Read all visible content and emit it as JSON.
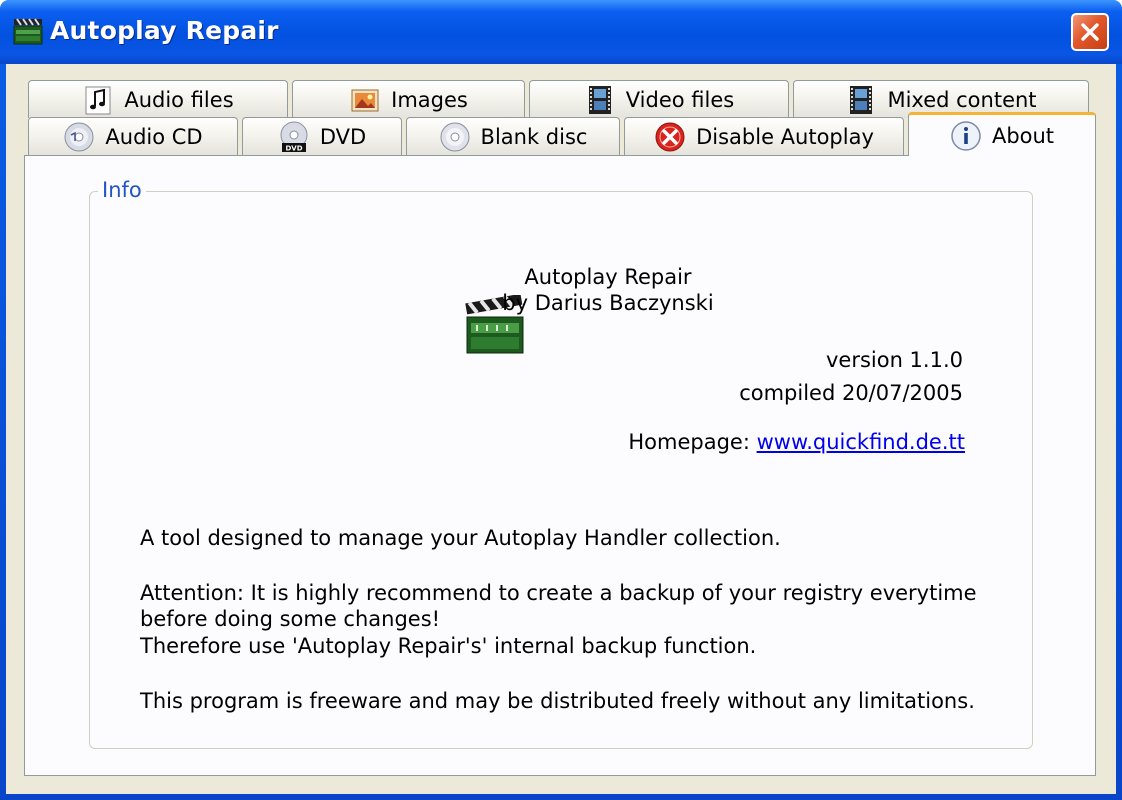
{
  "window": {
    "title": "Autoplay Repair",
    "close_icon": "close-icon",
    "accent": "#0a5ee6"
  },
  "tabs": {
    "row1": [
      {
        "label": "Audio files",
        "icon": "music-note-icon"
      },
      {
        "label": "Images",
        "icon": "image-icon"
      },
      {
        "label": "Video files",
        "icon": "film-icon"
      },
      {
        "label": "Mixed content",
        "icon": "film-icon"
      }
    ],
    "row2": [
      {
        "label": "Audio CD",
        "icon": "cd-icon"
      },
      {
        "label": "DVD",
        "icon": "dvd-icon"
      },
      {
        "label": "Blank disc",
        "icon": "blank-disc-icon"
      },
      {
        "label": "Disable Autoplay",
        "icon": "stop-icon"
      },
      {
        "label": "About",
        "icon": "info-icon",
        "active": true
      }
    ]
  },
  "about": {
    "group_title": "Info",
    "app_name": "Autoplay Repair",
    "author": "by Darius Baczynski",
    "version": "version 1.1.0",
    "compiled": "compiled 20/07/2005",
    "homepage_label": "Homepage:",
    "homepage_link": "www.quickfind.de.tt",
    "description": "A tool designed to manage your Autoplay Handler collection.",
    "attention_line1": "Attention: It is highly recommend to create a backup of your registry everytime",
    "attention_line2": "before doing some changes!",
    "attention_line3": "Therefore use 'Autoplay Repair's' internal backup function.",
    "freeware": "This program is freeware and may be distributed freely without any limitations."
  }
}
